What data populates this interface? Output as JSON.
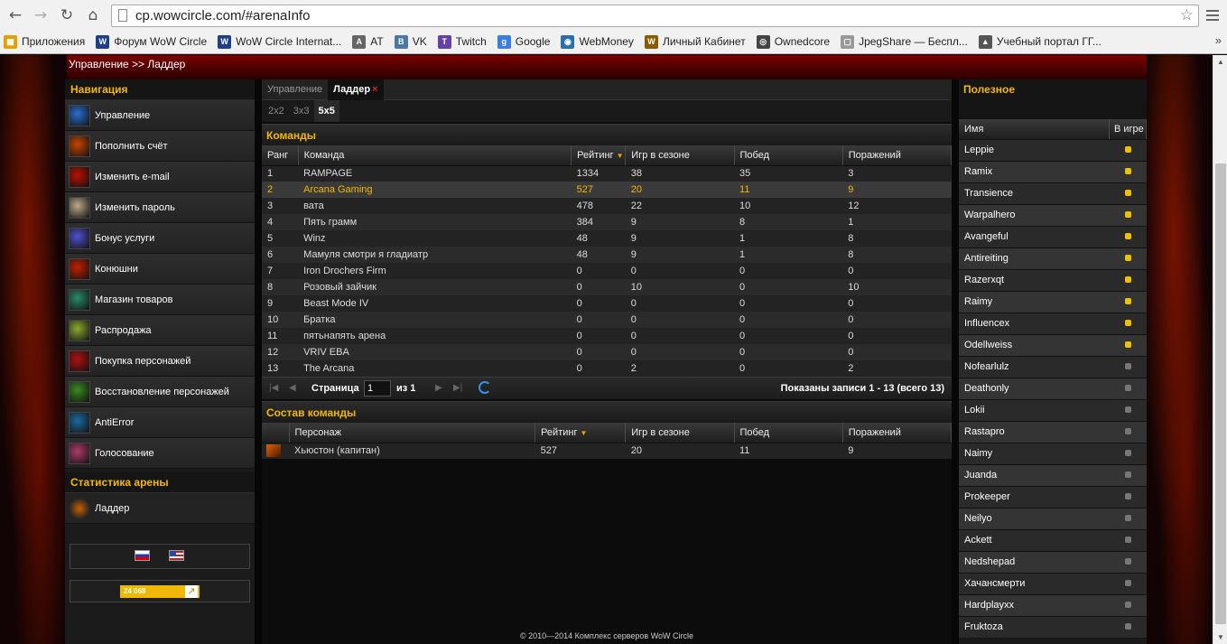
{
  "browser": {
    "url": "cp.wowcircle.com/#arenaInfo",
    "bookmarks": [
      {
        "label": "Приложения",
        "color": "#e8a000",
        "glyph": "▦"
      },
      {
        "label": "Форум WoW Circle",
        "color": "#1e3d8a",
        "glyph": "W"
      },
      {
        "label": "WoW Circle Internat...",
        "color": "#1e3d8a",
        "glyph": "W"
      },
      {
        "label": "AT",
        "color": "#666666",
        "glyph": "A"
      },
      {
        "label": "VK",
        "color": "#4a76a8",
        "glyph": "B"
      },
      {
        "label": "Twitch",
        "color": "#6441a5",
        "glyph": "T"
      },
      {
        "label": "Google",
        "color": "#3b7de8",
        "glyph": "g"
      },
      {
        "label": "WebMoney",
        "color": "#2b6fb0",
        "glyph": "◉"
      },
      {
        "label": "Личный Кабинет",
        "color": "#8a5a00",
        "glyph": "W"
      },
      {
        "label": "Ownedcore",
        "color": "#444444",
        "glyph": "◎"
      },
      {
        "label": "JpegShare — Беспл...",
        "color": "#999999",
        "glyph": "▢"
      },
      {
        "label": "Учебный портал ГГ...",
        "color": "#555555",
        "glyph": "▲"
      }
    ],
    "more": "»"
  },
  "breadcrumb": "Управление >> Ладдер",
  "nav": {
    "title": "Навигация",
    "items": [
      {
        "label": "Управление",
        "icon": "management-icon",
        "color": "#2a6fd0"
      },
      {
        "label": "Пополнить счёт",
        "icon": "topup-icon",
        "color": "#c84400"
      },
      {
        "label": "Изменить e-mail",
        "icon": "email-icon",
        "color": "#b81000"
      },
      {
        "label": "Изменить пароль",
        "icon": "password-icon",
        "color": "#bbaa88"
      },
      {
        "label": "Бонус услуги",
        "icon": "bonus-icon",
        "color": "#5050d0"
      },
      {
        "label": "Конюшни",
        "icon": "stable-icon",
        "color": "#c02000"
      },
      {
        "label": "Магазин товаров",
        "icon": "shop-icon",
        "color": "#2a8a6a"
      },
      {
        "label": "Распродажа",
        "icon": "sale-icon",
        "color": "#8aaa30"
      },
      {
        "label": "Покупка персонажей",
        "icon": "buy-char-icon",
        "color": "#b01010"
      },
      {
        "label": "Восстановление персонажей",
        "icon": "restore-char-icon",
        "color": "#3a8a20"
      },
      {
        "label": "AntiError",
        "icon": "antierror-icon",
        "color": "#1a6aa0"
      },
      {
        "label": "Голосование",
        "icon": "vote-icon",
        "color": "#b03a6a"
      }
    ],
    "arena_title": "Статистика арены",
    "arena_items": [
      {
        "label": "Ладдер",
        "icon": "ladder-icon",
        "color": "#c86000"
      }
    ],
    "counter": "24 068"
  },
  "main": {
    "tabs": [
      {
        "label": "Управление",
        "active": false
      },
      {
        "label": "Ладдер",
        "active": true,
        "close": "×"
      }
    ],
    "subtabs": [
      {
        "label": "2x2"
      },
      {
        "label": "3x3"
      },
      {
        "label": "5x5"
      }
    ],
    "teams_title": "Команды",
    "team_columns": [
      "Ранг",
      "Команда",
      "Рейтинг",
      "Игр в сезоне",
      "Побед",
      "Поражений"
    ],
    "teams": [
      [
        "1",
        "RAMPAGE",
        "1334",
        "38",
        "35",
        "3"
      ],
      [
        "2",
        "Arcana Gaming",
        "527",
        "20",
        "11",
        "9"
      ],
      [
        "3",
        "вата",
        "478",
        "22",
        "10",
        "12"
      ],
      [
        "4",
        "Пять грамм",
        "384",
        "9",
        "8",
        "1"
      ],
      [
        "5",
        "Winz",
        "48",
        "9",
        "1",
        "8"
      ],
      [
        "6",
        "Мамуля смотри я гладиатр",
        "48",
        "9",
        "1",
        "8"
      ],
      [
        "7",
        "Iron Drochers Firm",
        "0",
        "0",
        "0",
        "0"
      ],
      [
        "8",
        "Розовый зайчик",
        "0",
        "10",
        "0",
        "10"
      ],
      [
        "9",
        "Beast Mode IV",
        "0",
        "0",
        "0",
        "0"
      ],
      [
        "10",
        "Братка",
        "0",
        "0",
        "0",
        "0"
      ],
      [
        "11",
        "пятьнапять арена",
        "0",
        "0",
        "0",
        "0"
      ],
      [
        "12",
        "VRIV EBA",
        "0",
        "0",
        "0",
        "0"
      ],
      [
        "13",
        "The Arcana",
        "0",
        "2",
        "0",
        "2"
      ]
    ],
    "selected_team_index": 1,
    "pager": {
      "page_label": "Страница",
      "page_value": "1",
      "of_label": "из 1",
      "summary": "Показаны записи 1 - 13 (всего 13)"
    },
    "roster_title": "Состав команды",
    "roster_columns": [
      "Персонаж",
      "Рейтинг",
      "Игр в сезоне",
      "Побед",
      "Поражений"
    ],
    "roster": [
      [
        "Хьюстон (капитан)",
        "527",
        "20",
        "11",
        "9"
      ]
    ]
  },
  "right": {
    "title": "Полезное",
    "columns": [
      "Имя",
      "В игре"
    ],
    "players": [
      {
        "name": "Leppie",
        "online": true
      },
      {
        "name": "Ramix",
        "online": true
      },
      {
        "name": "Transience",
        "online": true
      },
      {
        "name": "Warpalhero",
        "online": true
      },
      {
        "name": "Avangeful",
        "online": true
      },
      {
        "name": "Antireiting",
        "online": true
      },
      {
        "name": "Razerxqt",
        "online": true
      },
      {
        "name": "Raimy",
        "online": true
      },
      {
        "name": "Influencex",
        "online": true
      },
      {
        "name": "Odellweiss",
        "online": true
      },
      {
        "name": "Nofearlulz",
        "online": false
      },
      {
        "name": "Deathonly",
        "online": false
      },
      {
        "name": "Lokii",
        "online": false
      },
      {
        "name": "Rastapro",
        "online": false
      },
      {
        "name": "Naimy",
        "online": false
      },
      {
        "name": "Juanda",
        "online": false
      },
      {
        "name": "Prokeeper",
        "online": false
      },
      {
        "name": "Neilyo",
        "online": false
      },
      {
        "name": "Ackett",
        "online": false
      },
      {
        "name": "Nedshepad",
        "online": false
      },
      {
        "name": "Хачансмерти",
        "online": false
      },
      {
        "name": "Hardplayxx",
        "online": false
      },
      {
        "name": "Fruktoza",
        "online": false
      }
    ]
  },
  "footer": "© 2010—2014 Комплекс серверов WoW Circle",
  "colors": {
    "accent": "#f5b800",
    "header_red": "#7a0000"
  }
}
